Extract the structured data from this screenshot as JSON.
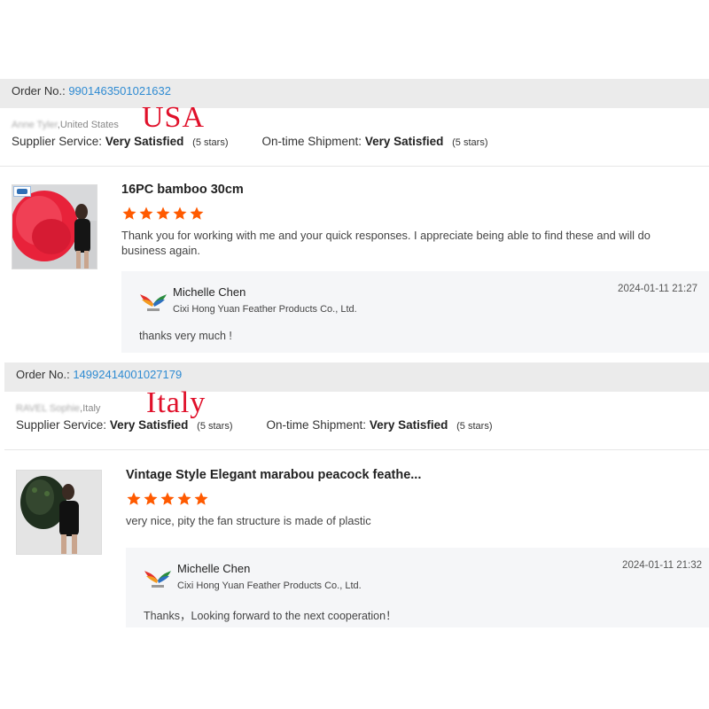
{
  "reviews": [
    {
      "order_label": "Order No.:",
      "order_number": "9901463501021632",
      "buyer_name": "Anne Tyler",
      "buyer_country": ",United States",
      "country_stamp": "USA",
      "supplier_label": "Supplier Service:",
      "supplier_value": "Very Satisfied",
      "supplier_stars": "(5 stars)",
      "shipment_label": "On-time Shipment:",
      "shipment_value": "Very Satisfied",
      "shipment_stars": "(5 stars)",
      "product_title": "16PC bamboo 30cm",
      "rating": 5,
      "comment": "Thank you for working with me and your quick responses.  I appreciate being able to find these and will do business again.",
      "reply": {
        "name": "Michelle Chen",
        "company": "Cixi Hong Yuan Feather Products Co., Ltd.",
        "date": "2024-01-11 21:27",
        "text": "thanks very much !"
      }
    },
    {
      "order_label": "Order No.:",
      "order_number": "14992414001027179",
      "buyer_name": "RAVEL Sophie",
      "buyer_country": ",Italy",
      "country_stamp": "Italy",
      "supplier_label": "Supplier Service:",
      "supplier_value": "Very Satisfied",
      "supplier_stars": "(5 stars)",
      "shipment_label": "On-time Shipment:",
      "shipment_value": "Very Satisfied",
      "shipment_stars": "(5 stars)",
      "product_title": "Vintage Style Elegant marabou peacock feathe...",
      "rating": 5,
      "comment": "very nice, pity the fan structure is made of plastic",
      "reply": {
        "name": "Michelle Chen",
        "company": "Cixi Hong Yuan Feather Products Co., Ltd.",
        "date": "2024-01-11 21:32",
        "text": "Thanks，Looking forward to the next cooperation！"
      }
    }
  ],
  "colors": {
    "order_link": "#2f8bd2",
    "stamp_red": "#e0102a",
    "star_orange": "#ff5a00",
    "order_bar_bg": "#ebebeb",
    "reply_bg": "#f5f6f8"
  },
  "icons": {
    "star": "star-icon",
    "supplier_logo": "wings-logo-icon",
    "verified_badge": "badge-icon"
  }
}
